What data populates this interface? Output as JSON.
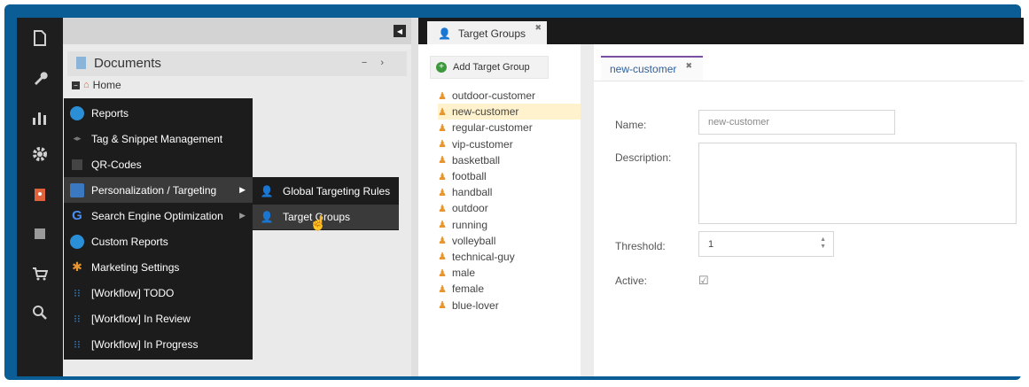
{
  "iconbar": {
    "items": [
      {
        "icon": "document-icon",
        "glyph": "🗋"
      },
      {
        "icon": "wrench-icon",
        "glyph": "🔧"
      },
      {
        "icon": "bar-chart-icon",
        "glyph": "▮"
      },
      {
        "icon": "gear-icon",
        "glyph": "⚙"
      },
      {
        "icon": "contact-book-icon",
        "glyph": "▣"
      },
      {
        "icon": "data-object-icon",
        "glyph": "▦"
      },
      {
        "icon": "cart-icon",
        "glyph": "🛒"
      },
      {
        "icon": "search-icon",
        "glyph": "🔍"
      }
    ]
  },
  "tree": {
    "collapse_glyph": "◀",
    "documents_title": "Documents",
    "controls": "− ›",
    "home_label": "Home"
  },
  "menu": {
    "items": [
      {
        "label": "Reports",
        "icon": "reports-icon",
        "has_arrow": false
      },
      {
        "label": "Tag & Snippet Management",
        "icon": "tag-icon",
        "has_arrow": false
      },
      {
        "label": "QR-Codes",
        "icon": "qr-code-icon",
        "has_arrow": false
      },
      {
        "label": "Personalization / Targeting",
        "icon": "personalization-icon",
        "has_arrow": true
      },
      {
        "label": "Search Engine Optimization",
        "icon": "google-icon",
        "has_arrow": true
      },
      {
        "label": "Custom Reports",
        "icon": "custom-reports-icon",
        "has_arrow": false
      },
      {
        "label": "Marketing Settings",
        "icon": "marketing-gear-icon",
        "has_arrow": false
      },
      {
        "label": "[Workflow] TODO",
        "icon": "workflow-icon",
        "has_arrow": false
      },
      {
        "label": "[Workflow] In Review",
        "icon": "workflow-icon",
        "has_arrow": false
      },
      {
        "label": "[Workflow] In Progress",
        "icon": "workflow-icon",
        "has_arrow": false
      }
    ],
    "highlighted_index": 3,
    "submenu": [
      {
        "label": "Global Targeting Rules",
        "icon": "targeting-person-icon"
      },
      {
        "label": "Target Groups",
        "icon": "target-group-icon"
      }
    ]
  },
  "tabs": {
    "main_tab_label": "Target Groups",
    "close_glyph": "✖"
  },
  "groups": {
    "add_button_label": "Add Target Group",
    "items": [
      "outdoor-customer",
      "new-customer",
      "regular-customer",
      "vip-customer",
      "basketball",
      "football",
      "handball",
      "outdoor",
      "running",
      "volleyball",
      "technical-guy",
      "male",
      "female",
      "blue-lover"
    ],
    "selected_index": 1
  },
  "detail": {
    "tab_label": "new-customer",
    "name_label": "Name:",
    "name_value": "new-customer",
    "description_label": "Description:",
    "description_value": "",
    "threshold_label": "Threshold:",
    "threshold_value": "1",
    "active_label": "Active:",
    "active_checked": true
  },
  "colors": {
    "frame": "#0b5d96",
    "menu_bg": "#1c1c1c",
    "selected_row": "#fff2cc",
    "tab_accent": "#7a4fa2"
  }
}
